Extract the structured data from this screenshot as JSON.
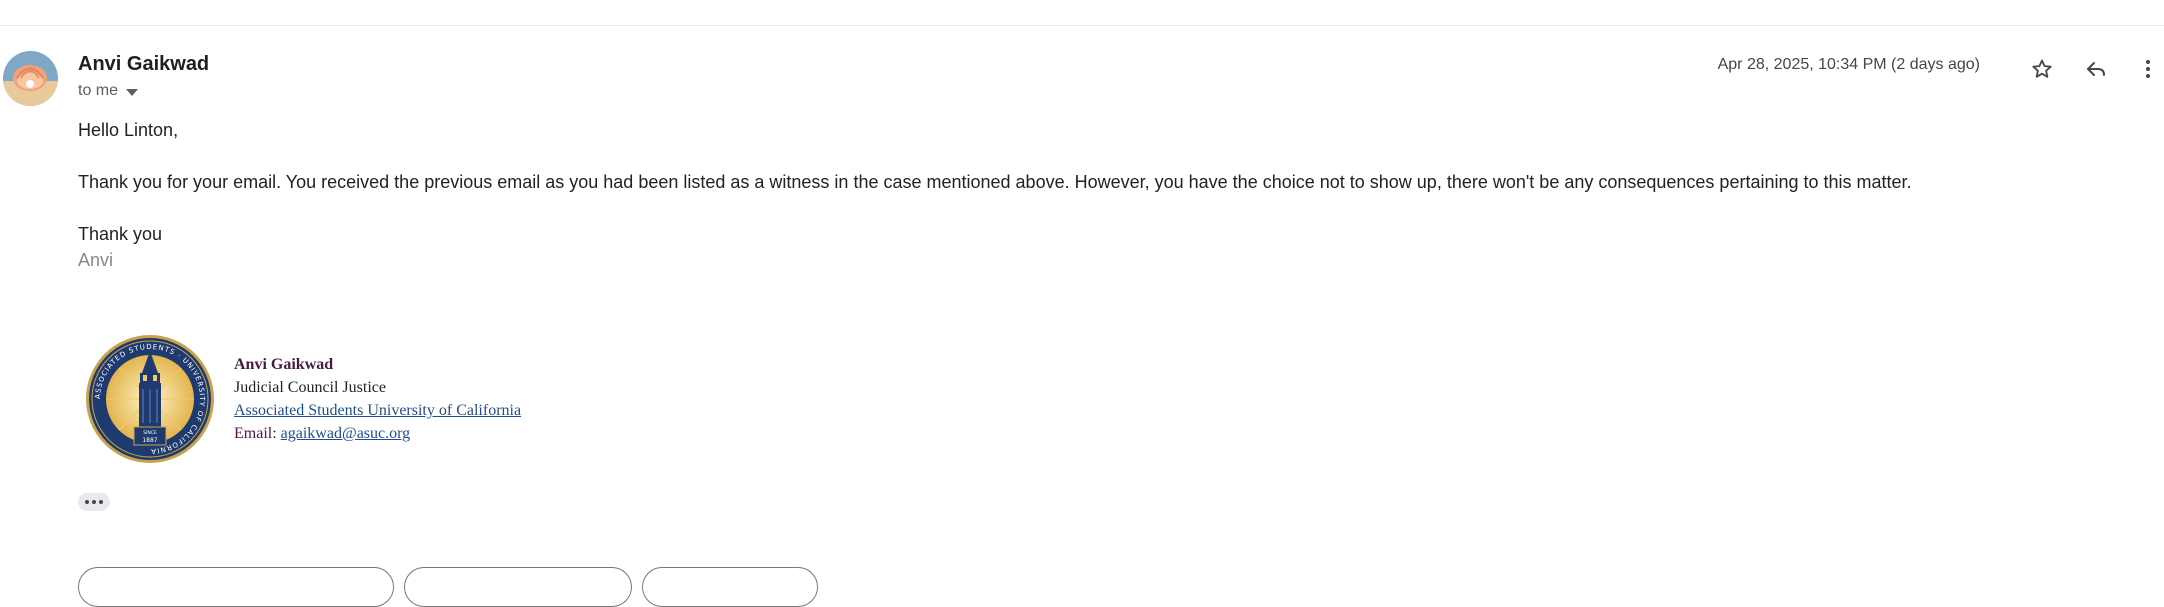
{
  "email": {
    "sender_name": "Anvi Gaikwad",
    "recipient_label": "to me",
    "timestamp": "Apr 28, 2025, 10:34 PM (2 days ago)",
    "greeting": "Hello Linton,",
    "paragraph": "Thank you for your email. You received the previous email as you had been listed as a witness in the case mentioned above. However, you have the choice not to show up, there won't be any consequences pertaining to this matter.",
    "closing": "Thank you",
    "signoff": "Anvi"
  },
  "signature": {
    "name": "Anvi Gaikwad",
    "title": "Judicial Council Justice",
    "organization": "Associated Students University of California",
    "email_label": "Email:",
    "email": "agaikwad@asuc.org",
    "seal_text_top": "ASSOCIATED STUDENTS · UNIVERSITY OF CALIFORNIA",
    "seal_year_label": "SINCE",
    "seal_year": "1887"
  },
  "icons": {
    "star": "star-icon",
    "reply": "reply-icon",
    "more": "more-vert-icon",
    "caret": "chevron-down-icon",
    "ellipsis": "ellipsis-icon"
  },
  "colors": {
    "sig_name": "#4a1942",
    "link": "#1f4e8c",
    "seal_blue": "#1e3a6e",
    "seal_gold": "#c9a24a"
  }
}
